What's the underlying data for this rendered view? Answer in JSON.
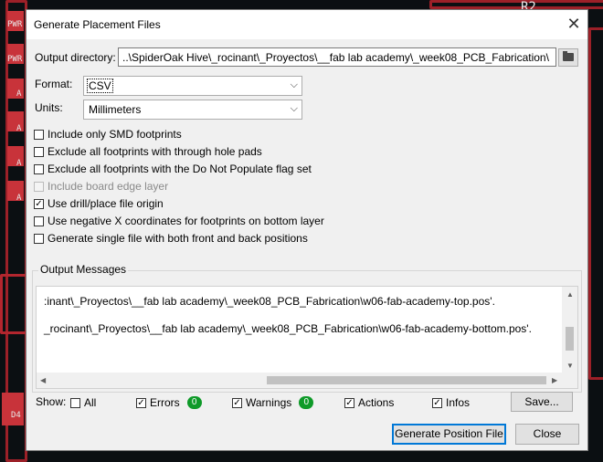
{
  "dialog": {
    "title": "Generate Placement Files",
    "close_glyph": "✕"
  },
  "output_dir": {
    "label": "Output directory:",
    "value": "..\\SpiderOak Hive\\_rocinant\\_Proyectos\\__fab lab academy\\_week08_PCB_Fabrication\\"
  },
  "format": {
    "label": "Format:",
    "value": "CSV"
  },
  "units": {
    "label": "Units:",
    "value": "Millimeters"
  },
  "options": [
    {
      "label": "Include only SMD footprints",
      "checked": false,
      "disabled": false
    },
    {
      "label": "Exclude all footprints with through hole pads",
      "checked": false,
      "disabled": false
    },
    {
      "label": "Exclude all footprints with the Do Not Populate flag set",
      "checked": false,
      "disabled": false
    },
    {
      "label": "Include board edge layer",
      "checked": false,
      "disabled": true
    },
    {
      "label": "Use drill/place file origin",
      "checked": true,
      "disabled": false
    },
    {
      "label": "Use negative X coordinates for footprints on bottom layer",
      "checked": false,
      "disabled": false
    },
    {
      "label": "Generate single file with both front and back positions",
      "checked": false,
      "disabled": false
    }
  ],
  "messages": {
    "title": "Output Messages",
    "lines": [
      ":inant\\_Proyectos\\__fab lab academy\\_week08_PCB_Fabrication\\w06-fab-academy-top.pos'.",
      "_rocinant\\_Proyectos\\__fab lab academy\\_week08_PCB_Fabrication\\w06-fab-academy-bottom.pos'."
    ]
  },
  "show": {
    "label": "Show:",
    "all": "All",
    "errors": "Errors",
    "errors_count": "0",
    "warnings": "Warnings",
    "warnings_count": "0",
    "actions": "Actions",
    "infos": "Infos",
    "save": "Save..."
  },
  "buttons": {
    "generate": "Generate Position File",
    "close": "Close"
  },
  "background": {
    "labels": [
      "PWR",
      "PWR",
      "A",
      "A",
      "A",
      "A",
      "D4",
      "R2"
    ]
  }
}
